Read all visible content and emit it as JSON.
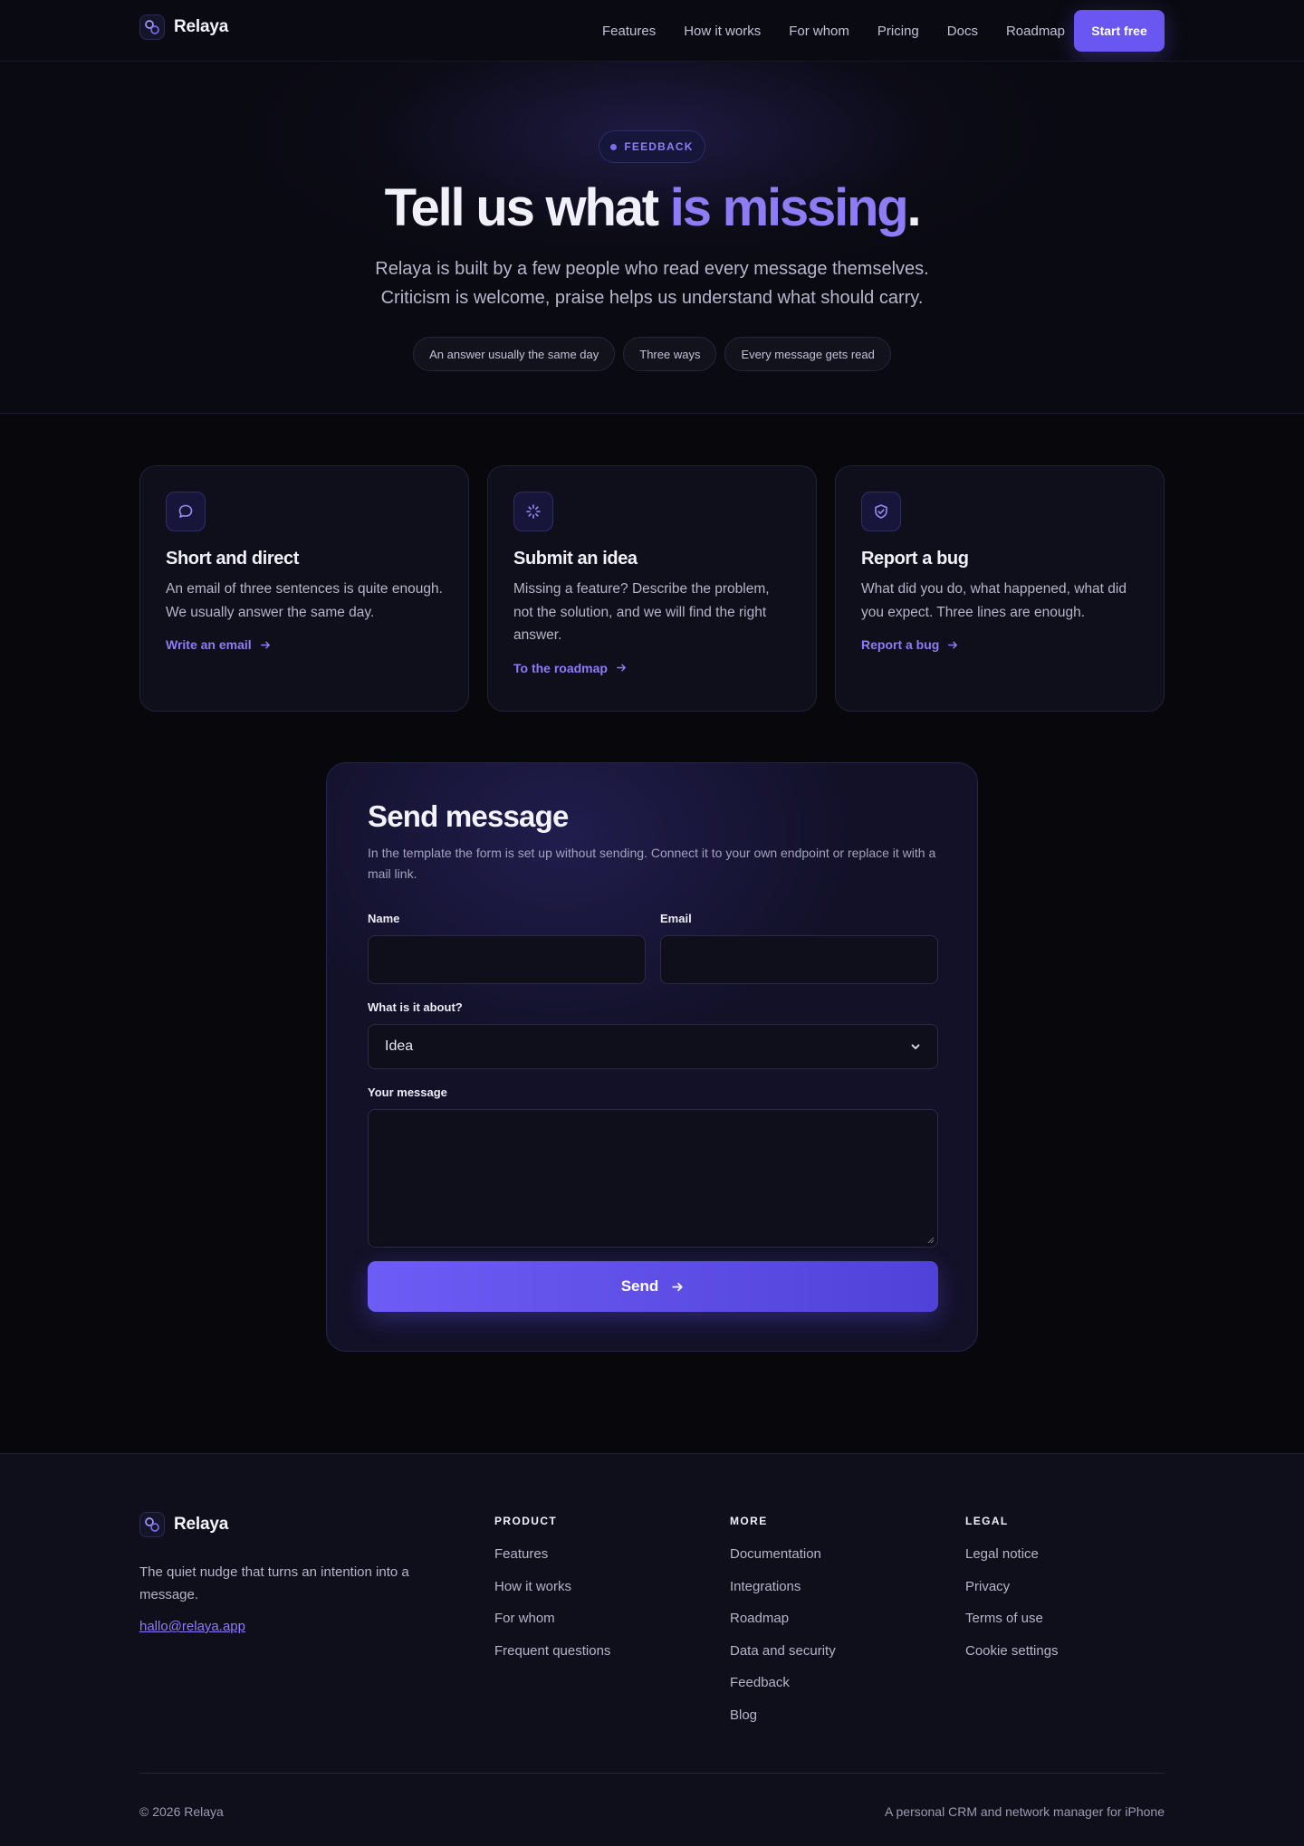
{
  "nav": {
    "brand": "Relaya",
    "links": [
      "Features",
      "How it works",
      "For whom",
      "Pricing",
      "Docs",
      "Roadmap"
    ],
    "cta": "Start free"
  },
  "hero": {
    "eyebrow": "FEEDBACK",
    "title_pre": "Tell us what ",
    "title_accent": "is missing",
    "title_post": ".",
    "subtitle_line1": "Relaya is built by a few people who read every message themselves.",
    "subtitle_line2": "Criticism is welcome, praise helps us understand what should carry.",
    "pills": [
      "An answer usually the same day",
      "Three ways",
      "Every message gets read"
    ]
  },
  "cards": [
    {
      "icon": "chat-bubble-icon",
      "title": "Short and direct",
      "body": "An email of three sentences is quite enough. We usually answer the same day.",
      "link": "Write an email"
    },
    {
      "icon": "sparkle-icon",
      "title": "Submit an idea",
      "body": "Missing a feature? Describe the problem, not the solution, and we will find the right answer.",
      "link": "To the roadmap"
    },
    {
      "icon": "shield-check-icon",
      "title": "Report a bug",
      "body": "What did you do, what happened, what did you expect. Three lines are enough.",
      "link": "Report a bug"
    }
  ],
  "form": {
    "title": "Send message",
    "note": "In the template the form is set up without sending. Connect it to your own endpoint or replace it with a mail link.",
    "name_label": "Name",
    "name_value": "",
    "email_label": "Email",
    "email_value": "",
    "topic_label": "What is it about?",
    "topic_value": "Idea",
    "message_label": "Your message",
    "message_value": "",
    "submit": "Send"
  },
  "footer": {
    "brand": "Relaya",
    "tagline": "The quiet nudge that turns an intention into a message.",
    "email": "hallo@relaya.app",
    "columns": [
      {
        "heading": "PRODUCT",
        "links": [
          "Features",
          "How it works",
          "For whom",
          "Frequent questions"
        ]
      },
      {
        "heading": "MORE",
        "links": [
          "Documentation",
          "Integrations",
          "Roadmap",
          "Data and security",
          "Feedback",
          "Blog"
        ]
      },
      {
        "heading": "LEGAL",
        "links": [
          "Legal notice",
          "Privacy",
          "Terms of use",
          "Cookie settings"
        ]
      }
    ],
    "copyright": "© 2026 Relaya",
    "claim": "A personal CRM and network manager for iPhone"
  },
  "colors": {
    "accent": "#8d7cf5",
    "button": "#6a56f0",
    "background": "#07070c",
    "card": "#0f0e1b"
  }
}
